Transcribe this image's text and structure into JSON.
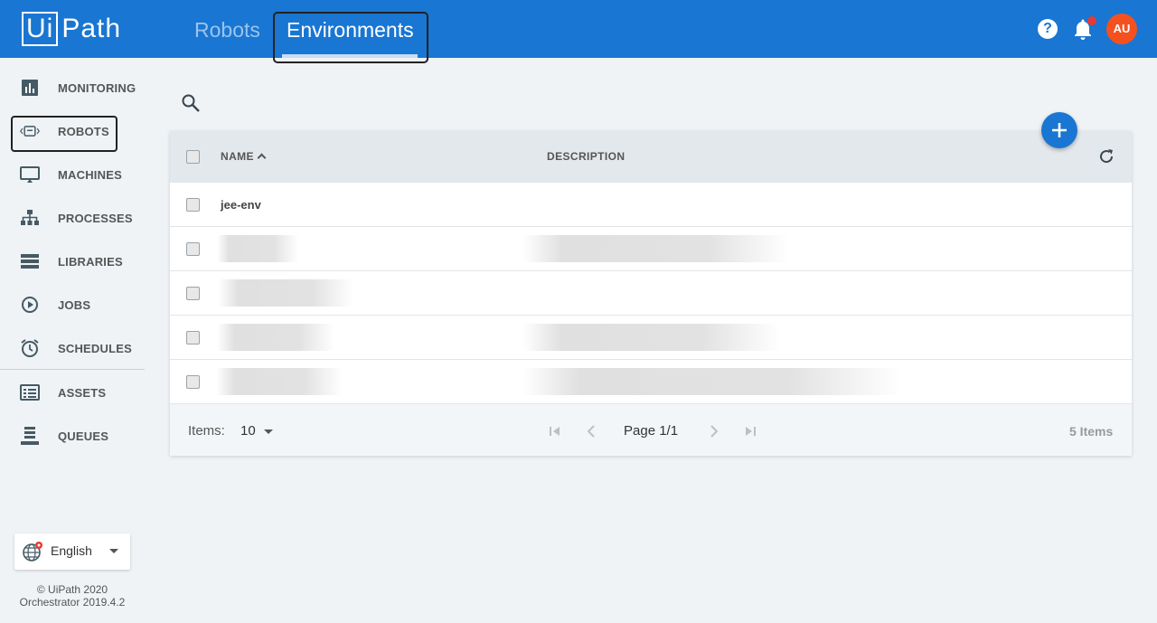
{
  "header": {
    "logo_ui": "Ui",
    "logo_path": "Path",
    "tabs": [
      {
        "label": "Robots",
        "active": false
      },
      {
        "label": "Environments",
        "active": true
      }
    ],
    "help_icon": "question-circle-icon",
    "notification_icon": "bell-icon",
    "avatar_initials": "AU"
  },
  "sidebar": {
    "items": [
      {
        "label": "MONITORING",
        "icon": "monitoring-icon"
      },
      {
        "label": "ROBOTS",
        "icon": "robot-icon"
      },
      {
        "label": "MACHINES",
        "icon": "monitor-icon"
      },
      {
        "label": "PROCESSES",
        "icon": "sitemap-icon"
      },
      {
        "label": "LIBRARIES",
        "icon": "list-icon"
      },
      {
        "label": "JOBS",
        "icon": "play-circle-icon"
      },
      {
        "label": "SCHEDULES",
        "icon": "alarm-icon"
      },
      {
        "label": "ASSETS",
        "icon": "assets-icon"
      },
      {
        "label": "QUEUES",
        "icon": "queue-icon"
      }
    ],
    "language": "English",
    "copyright": "© UiPath 2020",
    "version": "Orchestrator 2019.4.2"
  },
  "table": {
    "columns": {
      "name": "NAME",
      "description": "DESCRIPTION"
    },
    "rows": [
      {
        "name": "jee-env",
        "description": ""
      },
      {
        "name": "",
        "description": ""
      },
      {
        "name": "",
        "description": ""
      },
      {
        "name": "",
        "description": ""
      },
      {
        "name": "",
        "description": ""
      }
    ],
    "footer": {
      "items_label": "Items:",
      "items_per_page": "10",
      "page_text": "Page 1/1",
      "total_text": "5 Items"
    }
  },
  "colors": {
    "header_bg": "#1976d2",
    "accent": "#1976d2",
    "avatar_bg": "#f4511e",
    "notification_dot": "#e53935"
  }
}
